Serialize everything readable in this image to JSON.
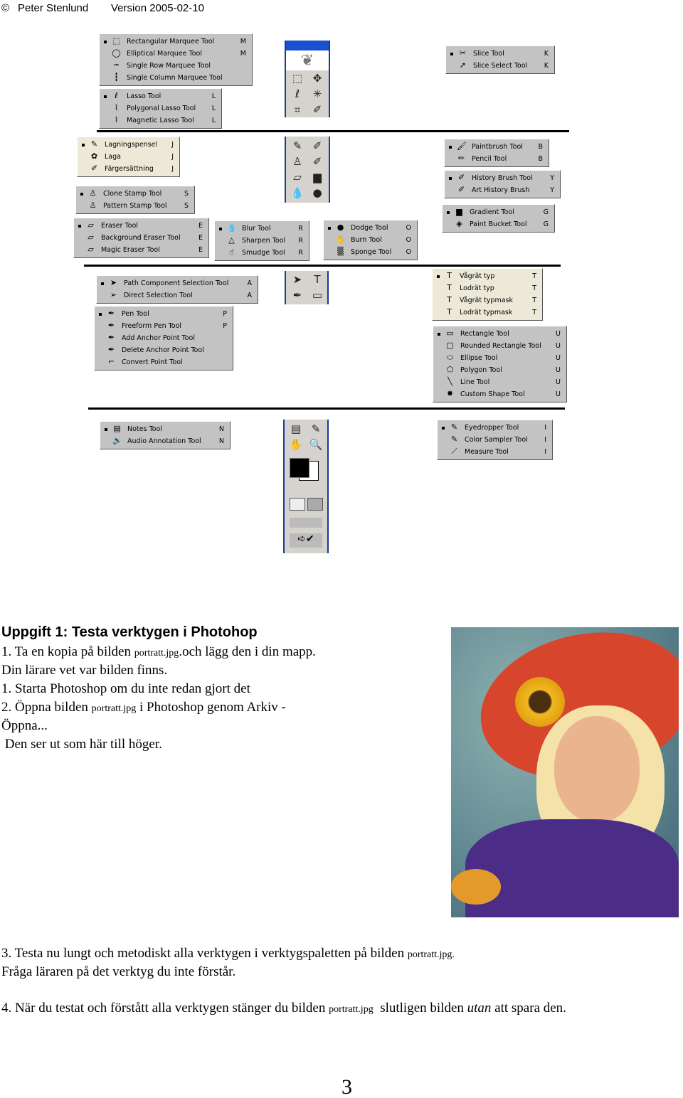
{
  "header": {
    "copyright": "©",
    "author": "Peter Stenlund",
    "version": "Version 2005-02-10"
  },
  "menus": [
    {
      "id": "marquee",
      "items": [
        {
          "icon": "rect-marquee-icon",
          "g": "⬚",
          "label": "Rectangular Marquee Tool",
          "key": "M",
          "sel": true
        },
        {
          "icon": "ellipse-marquee-icon",
          "g": "◯",
          "label": "Elliptical Marquee Tool",
          "key": "M"
        },
        {
          "icon": "row-marquee-icon",
          "g": "┅",
          "label": "Single Row Marquee Tool",
          "key": ""
        },
        {
          "icon": "column-marquee-icon",
          "g": "┇",
          "label": "Single Column Marquee Tool",
          "key": ""
        }
      ]
    },
    {
      "id": "lasso",
      "items": [
        {
          "icon": "lasso-icon",
          "g": "ℓ",
          "label": "Lasso Tool",
          "key": "L",
          "sel": true
        },
        {
          "icon": "polygonal-lasso-icon",
          "g": "⌇",
          "label": "Polygonal Lasso Tool",
          "key": "L"
        },
        {
          "icon": "magnetic-lasso-icon",
          "g": "⌇",
          "label": "Magnetic Lasso Tool",
          "key": "L"
        }
      ]
    },
    {
      "id": "healing",
      "beige": true,
      "items": [
        {
          "icon": "healing-brush-icon",
          "g": "✎",
          "label": "Lagningspensel",
          "key": "J",
          "sel": true
        },
        {
          "icon": "patch-icon",
          "g": "✿",
          "label": "Laga",
          "key": "J"
        },
        {
          "icon": "color-replace-icon",
          "g": "✐",
          "label": "Färgersättning",
          "key": "J"
        }
      ]
    },
    {
      "id": "stamp",
      "items": [
        {
          "icon": "clone-stamp-icon",
          "g": "♙",
          "label": "Clone Stamp Tool",
          "key": "S",
          "sel": true
        },
        {
          "icon": "pattern-stamp-icon",
          "g": "♙",
          "label": "Pattern Stamp Tool",
          "key": "S"
        }
      ]
    },
    {
      "id": "eraser",
      "items": [
        {
          "icon": "eraser-icon",
          "g": "▱",
          "label": "Eraser Tool",
          "key": "E",
          "sel": true
        },
        {
          "icon": "background-eraser-icon",
          "g": "▱",
          "label": "Background Eraser Tool",
          "key": "E"
        },
        {
          "icon": "magic-eraser-icon",
          "g": "▱",
          "label": "Magic Eraser Tool",
          "key": "E"
        }
      ]
    },
    {
      "id": "blur",
      "items": [
        {
          "icon": "blur-icon",
          "g": "💧",
          "label": "Blur Tool",
          "key": "R",
          "sel": true
        },
        {
          "icon": "sharpen-icon",
          "g": "△",
          "label": "Sharpen Tool",
          "key": "R"
        },
        {
          "icon": "smudge-icon",
          "g": "☝",
          "label": "Smudge Tool",
          "key": "R"
        }
      ]
    },
    {
      "id": "dodge",
      "items": [
        {
          "icon": "dodge-icon",
          "g": "●",
          "label": "Dodge Tool",
          "key": "O",
          "sel": true
        },
        {
          "icon": "burn-icon",
          "g": "✋",
          "label": "Burn Tool",
          "key": "O"
        },
        {
          "icon": "sponge-icon",
          "g": "▒",
          "label": "Sponge Tool",
          "key": "O"
        }
      ]
    },
    {
      "id": "slice",
      "items": [
        {
          "icon": "slice-icon",
          "g": "✂",
          "label": "Slice Tool",
          "key": "K",
          "sel": true
        },
        {
          "icon": "slice-select-icon",
          "g": "➚",
          "label": "Slice Select Tool",
          "key": "K"
        }
      ]
    },
    {
      "id": "brush",
      "items": [
        {
          "icon": "paintbrush-icon",
          "g": "🖌",
          "label": "Paintbrush Tool",
          "key": "B",
          "sel": true
        },
        {
          "icon": "pencil-icon",
          "g": "✏",
          "label": "Pencil Tool",
          "key": "B"
        }
      ]
    },
    {
      "id": "history",
      "items": [
        {
          "icon": "history-brush-icon",
          "g": "✐",
          "label": "History Brush Tool",
          "key": "Y",
          "sel": true
        },
        {
          "icon": "art-history-brush-icon",
          "g": "✐",
          "label": "Art History Brush",
          "key": "Y"
        }
      ]
    },
    {
      "id": "gradient",
      "items": [
        {
          "icon": "gradient-icon",
          "g": "▆",
          "label": "Gradient Tool",
          "key": "G",
          "sel": true
        },
        {
          "icon": "paint-bucket-icon",
          "g": "◈",
          "label": "Paint Bucket Tool",
          "key": "G"
        }
      ]
    },
    {
      "id": "pathsel",
      "items": [
        {
          "icon": "path-selection-icon",
          "g": "➤",
          "label": "Path Component Selection Tool",
          "key": "A",
          "sel": true
        },
        {
          "icon": "direct-selection-icon",
          "g": "➢",
          "label": "Direct Selection Tool",
          "key": "A"
        }
      ]
    },
    {
      "id": "pen",
      "items": [
        {
          "icon": "pen-icon",
          "g": "✒",
          "label": "Pen Tool",
          "key": "P",
          "sel": true
        },
        {
          "icon": "freeform-pen-icon",
          "g": "✒",
          "label": "Freeform Pen Tool",
          "key": "P"
        },
        {
          "icon": "add-anchor-icon",
          "g": "✒",
          "label": "Add Anchor Point Tool",
          "key": ""
        },
        {
          "icon": "delete-anchor-icon",
          "g": "✒",
          "label": "Delete Anchor Point Tool",
          "key": ""
        },
        {
          "icon": "convert-point-icon",
          "g": "⌐",
          "label": "Convert Point Tool",
          "key": ""
        }
      ]
    },
    {
      "id": "type",
      "beige": true,
      "items": [
        {
          "icon": "horizontal-type-icon",
          "g": "T",
          "label": "Vågrät typ",
          "key": "T",
          "sel": true
        },
        {
          "icon": "vertical-type-icon",
          "g": "T",
          "label": "Lodrät typ",
          "key": "T"
        },
        {
          "icon": "horizontal-type-mask-icon",
          "g": "T",
          "label": "Vågrät typmask",
          "key": "T"
        },
        {
          "icon": "vertical-type-mask-icon",
          "g": "T",
          "label": "Lodrät typmask",
          "key": "T"
        }
      ]
    },
    {
      "id": "shape",
      "items": [
        {
          "icon": "rectangle-icon",
          "g": "▭",
          "label": "Rectangle Tool",
          "key": "U",
          "sel": true
        },
        {
          "icon": "rounded-rectangle-icon",
          "g": "▢",
          "label": "Rounded Rectangle Tool",
          "key": "U"
        },
        {
          "icon": "ellipse-icon",
          "g": "⬭",
          "label": "Ellipse Tool",
          "key": "U"
        },
        {
          "icon": "polygon-icon",
          "g": "⬠",
          "label": "Polygon Tool",
          "key": "U"
        },
        {
          "icon": "line-icon",
          "g": "╲",
          "label": "Line Tool",
          "key": "U"
        },
        {
          "icon": "custom-shape-icon",
          "g": "✸",
          "label": "Custom Shape Tool",
          "key": "U"
        }
      ]
    },
    {
      "id": "notes",
      "items": [
        {
          "icon": "notes-icon",
          "g": "▤",
          "label": "Notes Tool",
          "key": "N",
          "sel": true
        },
        {
          "icon": "audio-annotation-icon",
          "g": "🔊",
          "label": "Audio Annotation Tool",
          "key": "N"
        }
      ]
    },
    {
      "id": "eyedropper",
      "items": [
        {
          "icon": "eyedropper-icon",
          "g": "✎",
          "label": "Eyedropper Tool",
          "key": "I",
          "sel": true
        },
        {
          "icon": "color-sampler-icon",
          "g": "✎",
          "label": "Color Sampler Tool",
          "key": "I"
        },
        {
          "icon": "measure-icon",
          "g": "⟋",
          "label": "Measure Tool",
          "key": "I"
        }
      ]
    }
  ],
  "toolbox": {
    "tools1": [
      "⬚",
      "✥",
      "ℓ",
      "✳",
      "⌗",
      "✐"
    ],
    "tools2": [
      "✎",
      "✐",
      "♙",
      "✐",
      "▱",
      "▆",
      "💧",
      "●"
    ],
    "tools3": [
      "➤",
      "T",
      "✒",
      "▭"
    ],
    "tools4": [
      "▤",
      "✎",
      "✋",
      "🔍"
    ]
  },
  "doc": {
    "heading": "Uppgift 1: Testa verktygen i Photohop",
    "l1a": "1. Ta en kopia på bilden ",
    "file": "portratt.jpg",
    "l1b": ".och lägg den  i din mapp.",
    "l2": "Din lärare vet var bilden finns.",
    "l3": "1. Starta Photoshop om du inte redan gjort det",
    "l4a": "2. Öppna bilden ",
    "l4b": "  i Photoshop genom Arkiv -",
    "l5": "Öppna...",
    "l6": " Den ser ut som här till höger.",
    "l7a": "3. Testa nu lungt och metodiskt alla verktygen i verktygspaletten på bilden ",
    "file2": "portratt.jpg.",
    "l8": "Fråga läraren på det verktyg du inte förstår.",
    "l9a": "4. När du testat och förstått alla verktygen stänger du bilden ",
    "l9b": "  slutligen bilden ",
    "l9c": "utan",
    "l9d": " att spara den.",
    "page_number": "3"
  }
}
